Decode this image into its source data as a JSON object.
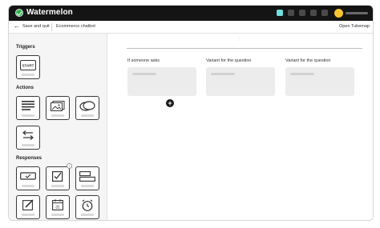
{
  "app": {
    "title": "Watermelon"
  },
  "toolbar": {
    "save_label": "Save and quit",
    "breadcrumb": "Ecommerce chatbot",
    "open_map_label": "Open Tubemap"
  },
  "sidebar": {
    "triggers_title": "Triggers",
    "start_label": "START",
    "actions_title": "Actions",
    "responses_title": "Responses",
    "badge_label": "i",
    "calendar_day": "31"
  },
  "canvas": {
    "columns": [
      {
        "title": "If someone asks"
      },
      {
        "title": "Variant for the question"
      },
      {
        "title": "Variant for the question"
      }
    ],
    "add_label": "+"
  },
  "colors": {
    "titlebar": "#141414",
    "logo_green": "#2db34a",
    "accent_teal": "#6fe0e0",
    "avatar_yellow": "#f7c531"
  }
}
